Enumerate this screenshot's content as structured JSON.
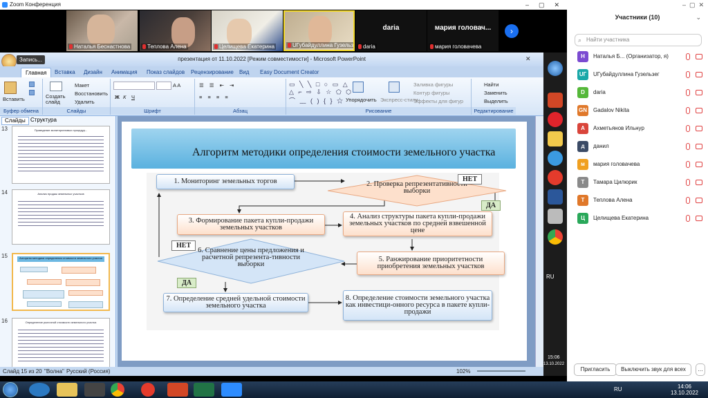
{
  "zoom": {
    "title": "Zoom Конференция",
    "tiles": [
      {
        "name": "Наталья Беснастнова",
        "muted": true
      },
      {
        "name": "Теплова Алена",
        "muted": true
      },
      {
        "name": "Целищева Екатерина",
        "muted": true
      },
      {
        "name": "UГубайдуллина Гузельзег",
        "muted": true
      },
      {
        "name": "daria",
        "label": "daria",
        "muted": true
      },
      {
        "name": "мария головачева",
        "label": "мария головач...",
        "muted": true
      }
    ],
    "next_arrow": "›"
  },
  "ppt": {
    "title": "презентация от 11.10.2022 [Режим совместимости] - Microsoft PowerPoint",
    "recording": "Запись...",
    "tabs": [
      "Главная",
      "Вставка",
      "Дизайн",
      "Анимация",
      "Показ слайдов",
      "Рецензирование",
      "Вид",
      "Easy Document Creator"
    ],
    "groups": {
      "clipboard": "Буфер обмена",
      "slides": "Слайды",
      "font": "Шрифт",
      "paragraph": "Абзац",
      "drawing": "Рисование",
      "editing": "Редактирование"
    },
    "ribbon_labels": {
      "paste": "Вставить",
      "create_slide": "Создать слайд",
      "layout": "Макет",
      "restore": "Восстановить",
      "delete": "Удалить",
      "arrange": "Упорядочить",
      "express_styles": "Экспресс-стили",
      "shape_fill": "Заливка фигуры",
      "shape_outline": "Контур фигуры",
      "shape_effects": "Эффекты для фигур",
      "find": "Найти",
      "replace": "Заменить",
      "select": "Выделить"
    },
    "pane_tabs": [
      "Слайды",
      "Структура"
    ],
    "thumb_numbers": [
      "13",
      "14",
      "15",
      "16"
    ],
    "thumb_titles": [
      "Проведение мониторинговых процедур...",
      "Анализ продаж земельных участков",
      "Алгоритм методики определения стоимости земельного участка",
      "Определение рыночной стоимости земельного участка"
    ],
    "status": {
      "slide": "Слайд 15 из 20",
      "theme": "\"Волна\"",
      "language": "Русский (Россия)",
      "zoom": "102%"
    }
  },
  "slide": {
    "title": "Алгоритм методики определения стоимости земельного участка",
    "steps": {
      "s1": "1. Мониторинг земельных торгов",
      "s2": "2. Проверка репрезентативности выборки",
      "s3": "3. Формирование пакета купли-продажи земельных участков",
      "s4": "4. Анализ структуры пакета купли-продажи земельных участков по средней взвешенной цене",
      "s5": "5. Ранжирование приоритетности приобретения земельных участков",
      "s6": "6. Сравнение цены предложения и расчетной репрезента-тивности выборки",
      "s7": "7. Определение средней удельной стоимости земельного участка",
      "s8": "8. Определение стоимости земельного участка как инвестици-онного ресурса в пакете купли-продажи"
    },
    "labels": {
      "no1": "НЕТ",
      "yes1": "ДА",
      "no2": "НЕТ",
      "yes2": "ДА"
    }
  },
  "participants": {
    "header": "Участники (10)",
    "search_placeholder": "Найти участника",
    "list": [
      {
        "initials": "Н",
        "name": "Наталья Б... (Организатор, я)",
        "color": "#7b4bd1"
      },
      {
        "initials": "UГ",
        "name": "UГубайдуллина Гузельзег",
        "color": "#1aa8a8"
      },
      {
        "initials": "D",
        "name": "daria",
        "color": "#55b83a"
      },
      {
        "initials": "GN",
        "name": "Gadalov Nikita",
        "color": "#e0782a"
      },
      {
        "initials": "А",
        "name": "Ахметьянов Ильнур",
        "color": "#d9453b"
      },
      {
        "initials": "д",
        "name": "данил",
        "color": "#3b4b66"
      },
      {
        "initials": "м",
        "name": "мария головачева",
        "color": "#f0a020"
      },
      {
        "initials": "Т",
        "name": "Тамара Цилюрик",
        "color": "#8a8a8a"
      },
      {
        "initials": "Т",
        "name": "Теплова Алена",
        "color": "#e0782a"
      },
      {
        "initials": "Ц",
        "name": "Целищева Екатерина",
        "color": "#2aa85a"
      }
    ],
    "invite": "Пригласить",
    "mute_all": "Выключить звук для всех"
  },
  "taskbar": {
    "lang": "RU",
    "time": "14:06",
    "date": "13.10.2022",
    "side_lang": "RU",
    "side_time": "15:06",
    "side_date": "13.10.2022"
  }
}
